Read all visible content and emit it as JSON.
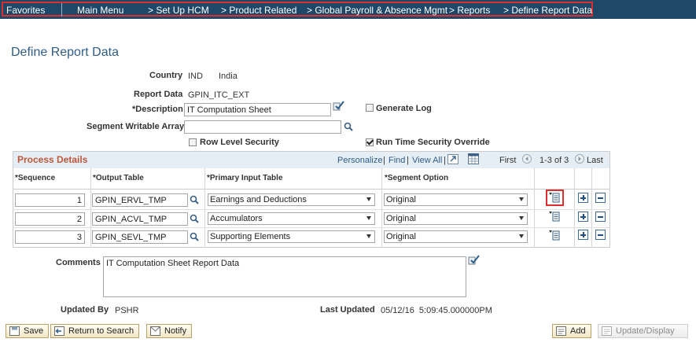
{
  "nav": {
    "favorites": "Favorites",
    "main_menu": "Main Menu",
    "crumbs": [
      "> Set Up HCM",
      "> Product Related",
      "> Global Payroll & Absence Mgmt",
      "> Reports",
      "> Define Report Data"
    ]
  },
  "page_title": "Define Report Data",
  "form": {
    "country_label": "Country",
    "country_code": "IND",
    "country_name": "India",
    "report_data_label": "Report Data",
    "report_data_value": "GPIN_ITC_EXT",
    "description_label": "*Description",
    "description_value": "IT Computation Sheet",
    "generate_log_label": "Generate Log",
    "generate_log_checked": false,
    "segment_array_label": "Segment Writable Array",
    "segment_array_value": "",
    "row_level_security_label": "Row Level Security",
    "row_level_security_checked": false,
    "run_time_override_label": "Run Time Security Override",
    "run_time_override_checked": true
  },
  "grid": {
    "title": "Process Details",
    "personalize": "Personalize",
    "sep1": "|",
    "find": "Find",
    "sep2": "|",
    "view_all": "View All",
    "sep3": "|",
    "first": "First",
    "range": "1-3 of 3",
    "last": "Last",
    "columns": {
      "sequence": "*Sequence",
      "output_table": "*Output Table",
      "primary_input_table": "*Primary Input Table",
      "segment_option": "*Segment Option"
    },
    "rows": [
      {
        "sequence": "1",
        "output_table": "GPIN_ERVL_TMP",
        "primary_input_table": "Earnings and Deductions",
        "segment_option": "Original"
      },
      {
        "sequence": "2",
        "output_table": "GPIN_ACVL_TMP",
        "primary_input_table": "Accumulators",
        "segment_option": "Original"
      },
      {
        "sequence": "3",
        "output_table": "GPIN_SEVL_TMP",
        "primary_input_table": "Supporting Elements",
        "segment_option": "Original"
      }
    ]
  },
  "comments": {
    "label": "Comments",
    "value": "IT Computation Sheet Report Data"
  },
  "footer": {
    "updated_by_label": "Updated By",
    "updated_by_value": "PSHR",
    "last_updated_label": "Last Updated",
    "last_updated_value": "05/12/16  5:09:45.000000PM"
  },
  "buttons": {
    "save": "Save",
    "return_to_search": "Return to Search",
    "notify": "Notify",
    "add": "Add",
    "update_display": "Update/Display"
  },
  "colors": {
    "nav_bg": "#1f4767",
    "highlight": "#d9302f",
    "title": "#2e5d89",
    "grid_title": "#c0563a"
  }
}
